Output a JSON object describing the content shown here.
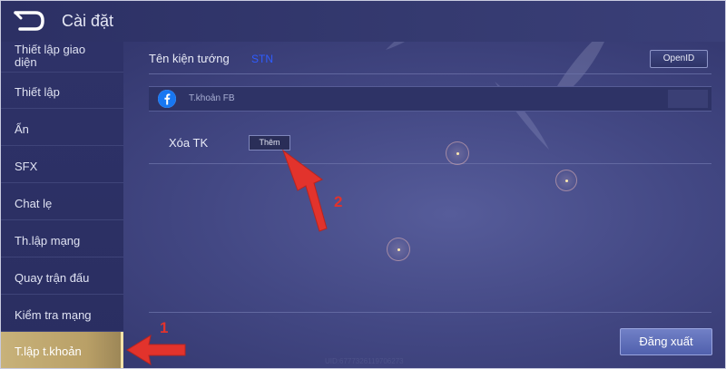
{
  "header": {
    "title": "Cài đặt",
    "back_icon": "back-arrow-icon"
  },
  "sidebar": {
    "items": [
      {
        "label": "Thiết lập giao diện",
        "active": false
      },
      {
        "label": "Thiết lập",
        "active": false
      },
      {
        "label": "Ẩn",
        "active": false
      },
      {
        "label": "SFX",
        "active": false
      },
      {
        "label": "Chat lẹ",
        "active": false
      },
      {
        "label": "Th.lập mạng",
        "active": false
      },
      {
        "label": "Quay trận đấu",
        "active": false
      },
      {
        "label": "Kiểm tra mạng",
        "active": false
      },
      {
        "label": "T.lập t.khoản",
        "active": true
      }
    ]
  },
  "account": {
    "hero_name_label": "Tên kiện tướng",
    "hero_name_value": "STN",
    "openid_button": "OpenID",
    "facebook": {
      "icon": "facebook-icon",
      "label": "T.khoản FB"
    },
    "delete_label": "Xóa TK",
    "add_button": "Thêm",
    "logout_button": "Đăng xuất",
    "uid_text": "UID:6777326119706273"
  },
  "annotations": {
    "step1": "1",
    "step2": "2",
    "color": "#e2332c"
  },
  "colors": {
    "background": "#3a3f78",
    "sidebar": "#2c3064",
    "active_item": "#c8b27a",
    "hero_name": "#2f5cff",
    "logout": "#6272bb"
  }
}
